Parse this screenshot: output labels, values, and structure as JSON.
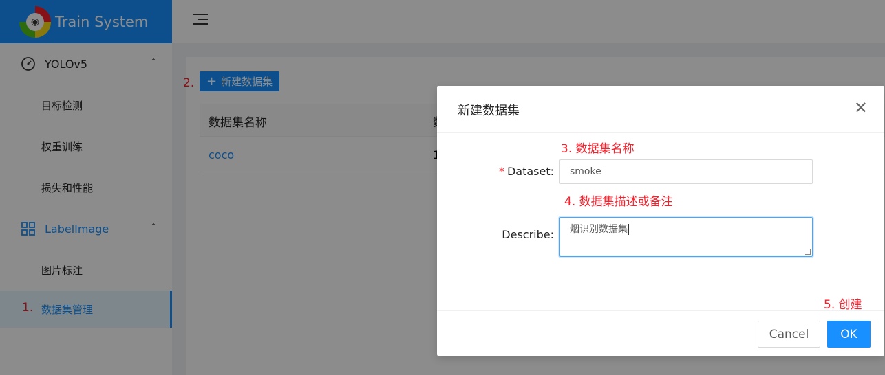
{
  "app": {
    "title": "Train System"
  },
  "sidebar": {
    "groups": [
      {
        "label": "YOLOv5",
        "icon": "dashboard-icon",
        "items": [
          "目标检测",
          "权重训练",
          "损失和性能"
        ]
      },
      {
        "label": "LabelImage",
        "icon": "appstore-icon",
        "items": [
          "图片标注",
          "数据集管理"
        ]
      }
    ],
    "active": "数据集管理"
  },
  "steps": {
    "s1": "1.",
    "s2": "2.",
    "s3": "3. 数据集名称",
    "s4": "4. 数据集描述或备注",
    "s5": "5. 创建"
  },
  "toolbar": {
    "new_label": "新建数据集"
  },
  "table": {
    "headers": [
      "数据集名称",
      "数"
    ],
    "rows": [
      {
        "name": "coco",
        "col2": "1"
      }
    ]
  },
  "modal": {
    "title": "新建数据集",
    "dataset_label": "Dataset",
    "dataset_value": "smoke",
    "describe_label": "Describe",
    "describe_value": "烟识别数据集",
    "cancel": "Cancel",
    "ok": "OK"
  }
}
